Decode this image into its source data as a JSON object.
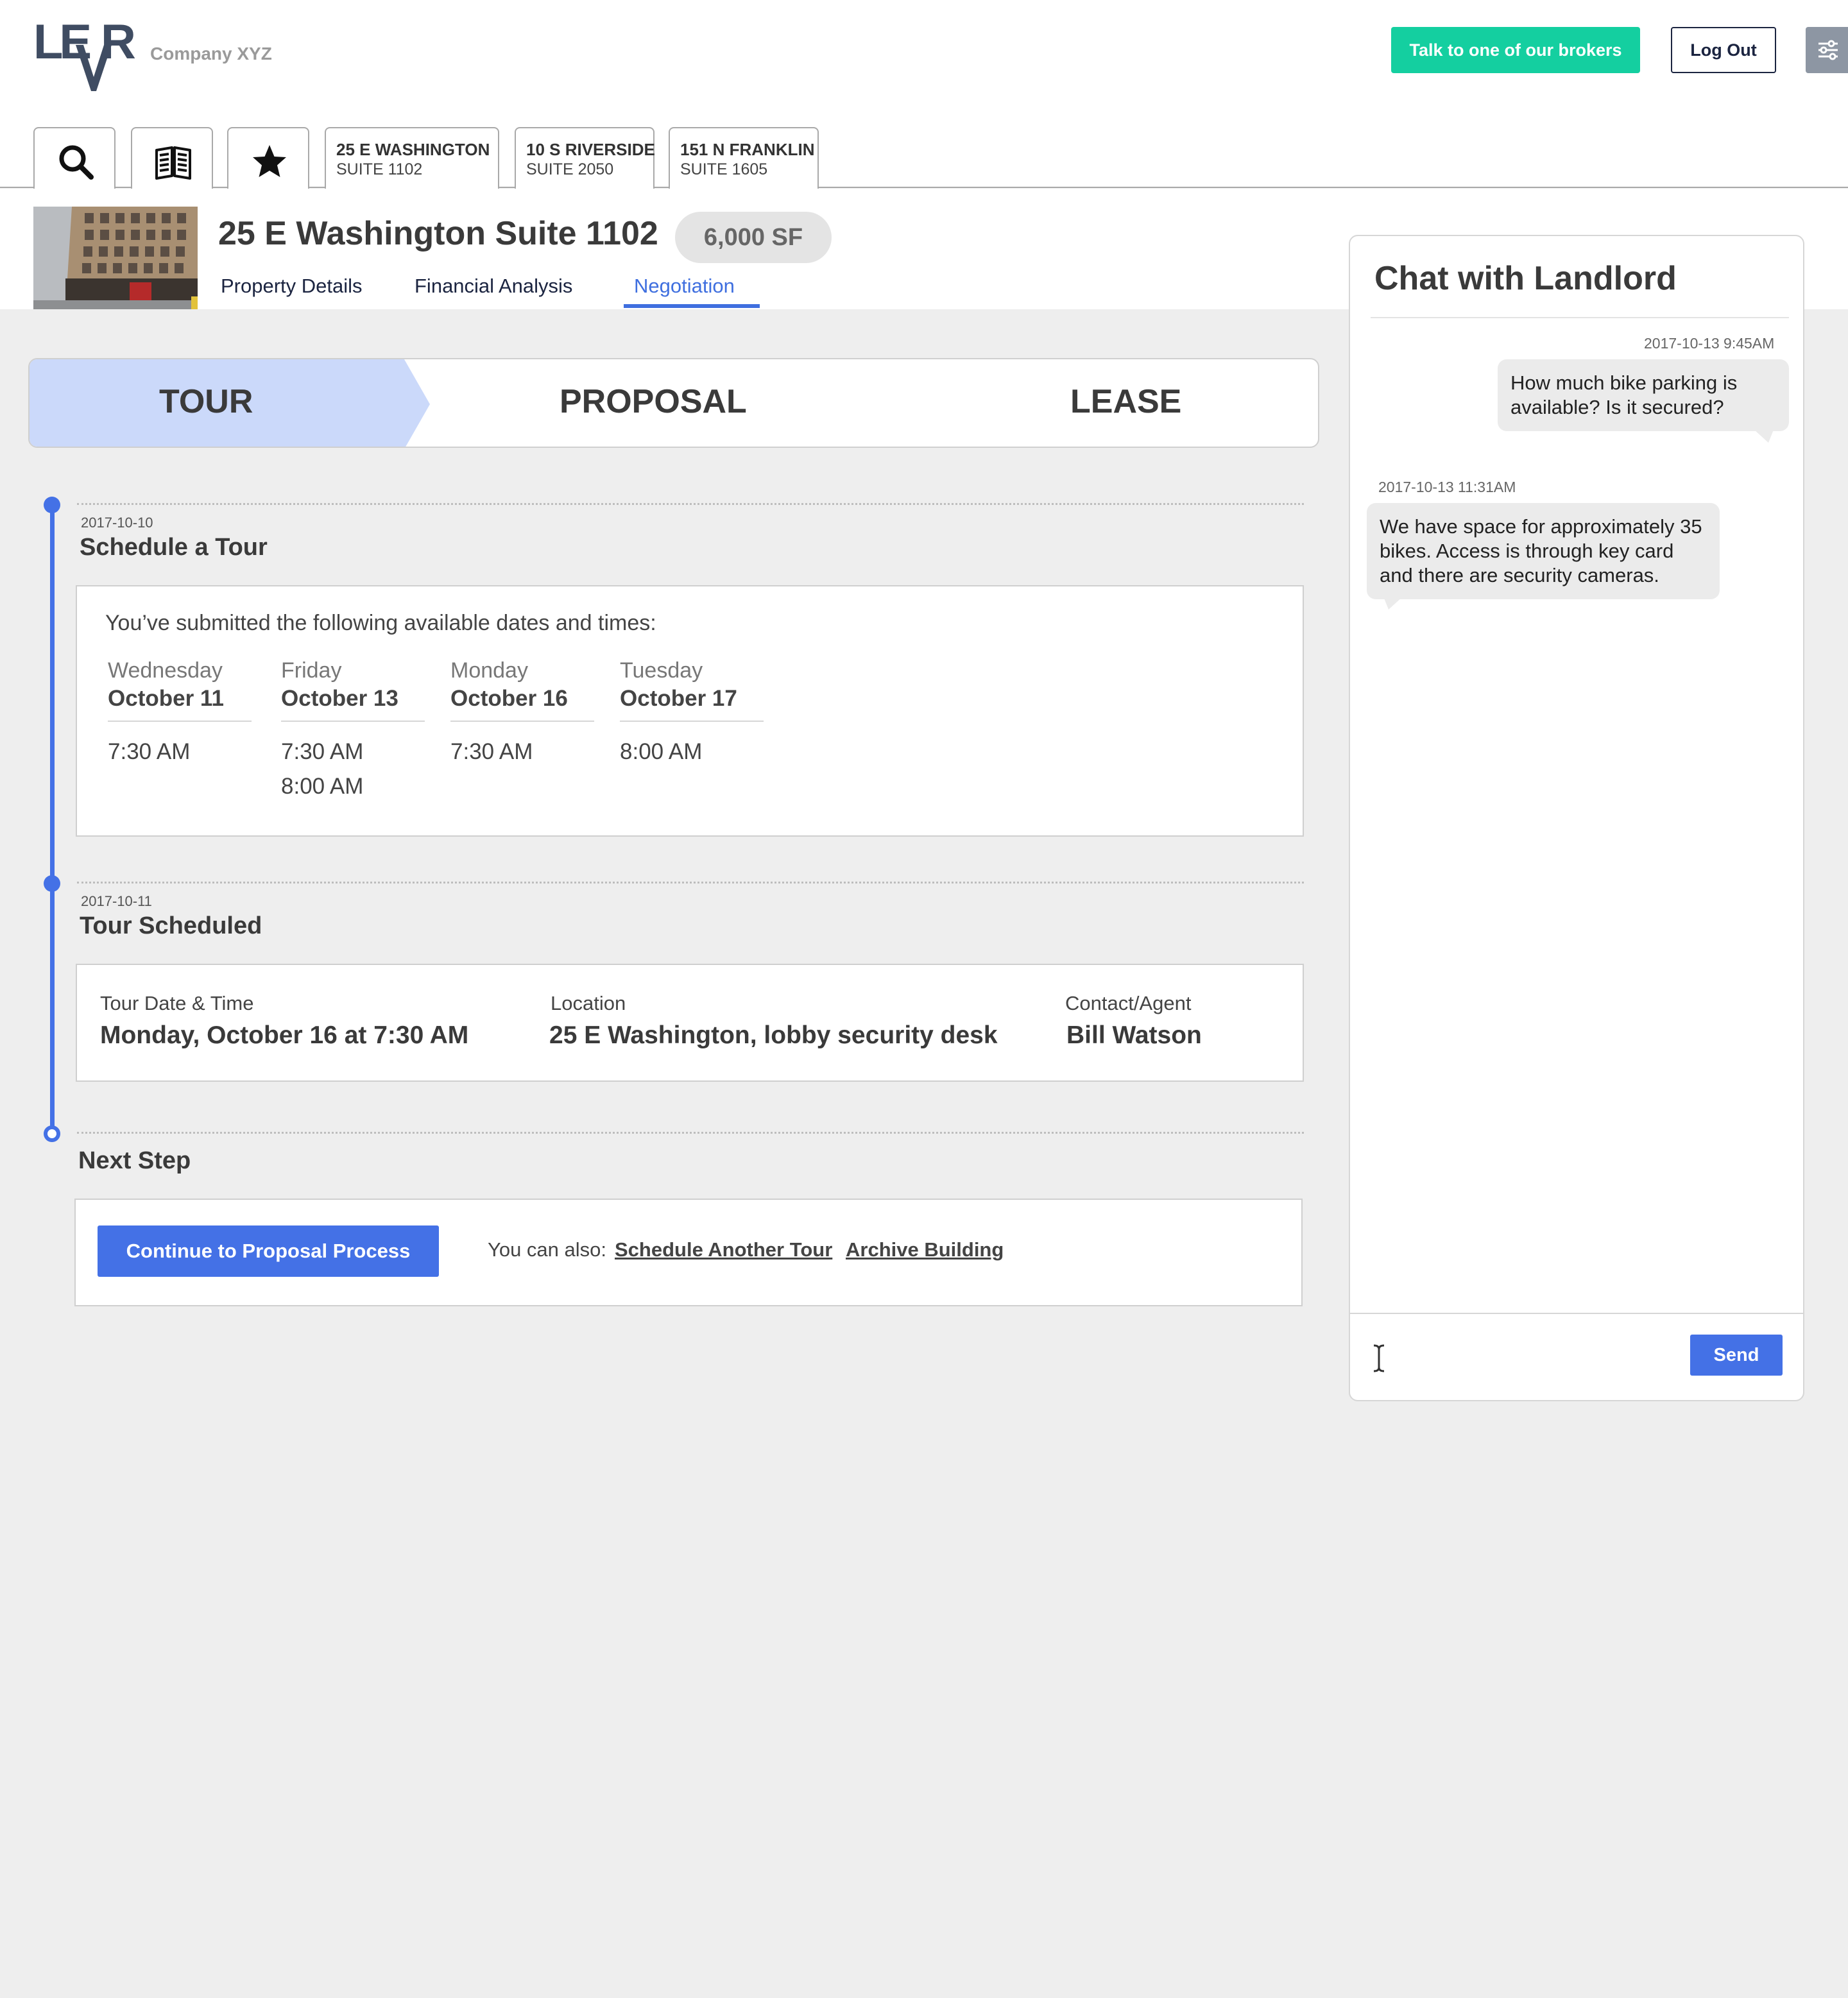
{
  "header": {
    "logo_text_a": "LE",
    "logo_text_b": "R",
    "company": "Company XYZ",
    "brokers_button": "Talk to one of our brokers",
    "logout_button": "Log Out",
    "settings_icon": "sliders-icon",
    "accent_color": "#14cfa0"
  },
  "tabs": {
    "icon_tabs": [
      "search-icon",
      "book-icon",
      "star-icon"
    ],
    "properties": [
      {
        "line1": "25 E WASHINGTON",
        "line2": "SUITE 1102"
      },
      {
        "line1": "10 S RIVERSIDE",
        "line2": "SUITE 2050"
      },
      {
        "line1": "151 N FRANKLIN",
        "line2": "SUITE 1605"
      }
    ]
  },
  "property": {
    "title": "25 E Washington Suite 1102",
    "size_badge": "6,000 SF",
    "subtabs": [
      "Property Details",
      "Financial Analysis",
      "Negotiation"
    ],
    "active_subtab": "Negotiation"
  },
  "stages": {
    "items": [
      "TOUR",
      "PROPOSAL",
      "LEASE"
    ],
    "active": "TOUR",
    "active_color": "#cbd9fa"
  },
  "timeline": {
    "schedule": {
      "date": "2017-10-10",
      "title": "Schedule a Tour",
      "intro": "You’ve submitted the following available dates and times:",
      "days": [
        {
          "day": "Wednesday",
          "date": "October 11",
          "times": [
            "7:30 AM"
          ]
        },
        {
          "day": "Friday",
          "date": "October 13",
          "times": [
            "7:30 AM",
            "8:00 AM"
          ]
        },
        {
          "day": "Monday",
          "date": "October 16",
          "times": [
            "7:30 AM"
          ]
        },
        {
          "day": "Tuesday",
          "date": "October 17",
          "times": [
            "8:00 AM"
          ]
        }
      ]
    },
    "scheduled": {
      "date": "2017-10-11",
      "title": "Tour Scheduled",
      "datetime_label": "Tour Date & Time",
      "datetime_value": "Monday, October 16 at 7:30 AM",
      "location_label": "Location",
      "location_value": "25 E Washington, lobby security desk",
      "contact_label": "Contact/Agent",
      "contact_value": "Bill Watson"
    },
    "next": {
      "title": "Next Step",
      "continue_button": "Continue to Proposal Process",
      "also_text": "You can also:",
      "link_schedule": "Schedule Another Tour",
      "link_archive": "Archive Building"
    }
  },
  "chat": {
    "title": "Chat with Landlord",
    "messages": [
      {
        "time": "2017-10-13 9:45AM",
        "text": "How much bike parking is available? Is it secured?",
        "side": "right"
      },
      {
        "time": "2017-10-13 11:31AM",
        "text": "We have space for approximately 35 bikes. Access is through key card and there are security cameras.",
        "side": "left"
      }
    ],
    "input_placeholder": "",
    "send_button": "Send",
    "primary_color": "#4471e6"
  }
}
